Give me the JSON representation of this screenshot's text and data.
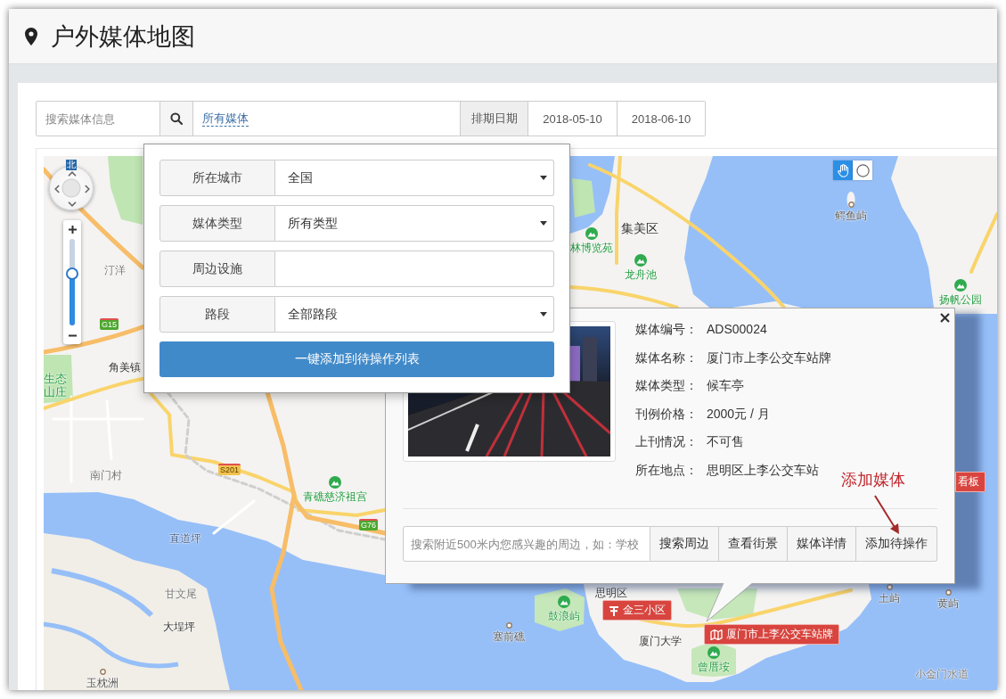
{
  "header": {
    "title": "户外媒体地图"
  },
  "toolbar": {
    "search": {
      "placeholder": "搜索媒体信息"
    },
    "media_filter": "所有媒体",
    "schedule_label": "排期日期",
    "start_date": "2018-05-10",
    "end_date": "2018-06-10"
  },
  "filter_panel": {
    "rows": [
      {
        "label": "所在城市",
        "kind": "select",
        "value": "全国"
      },
      {
        "label": "媒体类型",
        "kind": "select",
        "value": "所有类型"
      },
      {
        "label": "周边设施",
        "kind": "input"
      },
      {
        "label": "路段",
        "kind": "select",
        "value": "全部路段"
      }
    ],
    "button": "一键添加到待操作列表"
  },
  "map": {
    "compass_label": "北",
    "zoom": {
      "level": 0.6
    },
    "tools": [
      {
        "kind": "pan",
        "selected": true
      },
      {
        "kind": "circle",
        "selected": false
      }
    ],
    "labels": [
      {
        "text": "汀洋",
        "kind": "place"
      },
      {
        "text": "角美镇",
        "kind": "town"
      },
      {
        "text": "生态山庄",
        "kind": "green"
      },
      {
        "text": "南门村",
        "kind": "place"
      },
      {
        "text": "青礁慈济祖宫",
        "kind": "park"
      },
      {
        "text": "直道坪",
        "kind": "water"
      },
      {
        "text": "甘文尾",
        "kind": "place"
      },
      {
        "text": "大埕坪",
        "kind": "town"
      },
      {
        "text": "玉枕洲",
        "kind": "island"
      },
      {
        "text": "塞前礁",
        "kind": "island"
      },
      {
        "text": "鼓浪屿",
        "kind": "park"
      },
      {
        "text": "思明区",
        "kind": "town"
      },
      {
        "text": "厦门大学",
        "kind": "town"
      },
      {
        "text": "曾厝垵",
        "kind": "park"
      },
      {
        "text": "土屿",
        "kind": "island"
      },
      {
        "text": "黄屿",
        "kind": "island"
      },
      {
        "text": "小金门水道",
        "kind": "place"
      },
      {
        "text": "集美区",
        "kind": "district"
      },
      {
        "text": "林博览苑",
        "kind": "park"
      },
      {
        "text": "龙舟池",
        "kind": "park"
      },
      {
        "text": "鳄鱼屿",
        "kind": "island"
      },
      {
        "text": "扬帆公园",
        "kind": "park"
      }
    ],
    "road_shields": [
      {
        "text": "G15",
        "color": "#4da82f"
      },
      {
        "text": "S201",
        "color": "#f3c24f"
      },
      {
        "text": "G76",
        "color": "#4da82f"
      }
    ],
    "markers": [
      {
        "text": "金三小区",
        "kind": "sign"
      },
      {
        "text": "厦门市上李公交车站牌",
        "kind": "map"
      },
      {
        "text": "看板",
        "kind": "plain"
      }
    ]
  },
  "info_window": {
    "fields": [
      {
        "label": "媒体编号：",
        "value": "ADS00024"
      },
      {
        "label": "媒体名称：",
        "value": "厦门市上李公交车站牌"
      },
      {
        "label": "媒体类型：",
        "value": "候车亭"
      },
      {
        "label": "刊例价格：",
        "value": "2000元 / 月"
      },
      {
        "label": "上刊情况：",
        "value": "不可售"
      },
      {
        "label": "所在地点：",
        "value": "思明区上李公交车站"
      }
    ],
    "search": {
      "placeholder": "搜索附近500米内您感兴趣的周边，如：学校"
    },
    "buttons": [
      "搜索周边",
      "查看街景",
      "媒体详情",
      "添加待操作"
    ],
    "annotation": "添加媒体"
  }
}
